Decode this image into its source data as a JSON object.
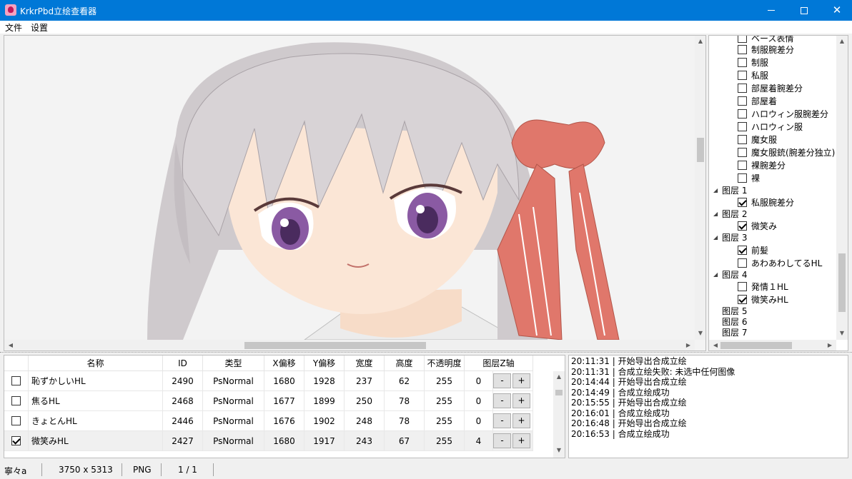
{
  "window": {
    "title": "KrkrPbd立绘查看器"
  },
  "menu": {
    "file": "文件",
    "settings": "设置"
  },
  "tree": {
    "items": [
      {
        "label": "ベース表情",
        "checked": false
      },
      {
        "label": "制服腕差分",
        "checked": false
      },
      {
        "label": "制服",
        "checked": false
      },
      {
        "label": "私服",
        "checked": false
      },
      {
        "label": "部屋着腕差分",
        "checked": false
      },
      {
        "label": "部屋着",
        "checked": false
      },
      {
        "label": "ハロウィン服腕差分",
        "checked": false
      },
      {
        "label": "ハロウィン服",
        "checked": false
      },
      {
        "label": "魔女服",
        "checked": false
      },
      {
        "label": "魔女服銃(腕差分独立)",
        "checked": false
      },
      {
        "label": "裸腕差分",
        "checked": false
      },
      {
        "label": "裸",
        "checked": false
      }
    ],
    "groups": [
      {
        "label": "图层 1",
        "expanded": true,
        "children": [
          {
            "label": "私服腕差分",
            "checked": true
          }
        ]
      },
      {
        "label": "图层 2",
        "expanded": true,
        "children": [
          {
            "label": "微笑み",
            "checked": true
          }
        ]
      },
      {
        "label": "图层 3",
        "expanded": true,
        "children": [
          {
            "label": "前髪",
            "checked": true
          },
          {
            "label": "あわあわしてるHL",
            "checked": false
          }
        ]
      },
      {
        "label": "图层 4",
        "expanded": true,
        "children": [
          {
            "label": "発情１HL",
            "checked": false
          },
          {
            "label": "微笑みHL",
            "checked": true
          }
        ]
      },
      {
        "label": "图层 5"
      },
      {
        "label": "图层 6"
      },
      {
        "label": "图层 7"
      }
    ]
  },
  "table": {
    "columns": [
      "名称",
      "ID",
      "类型",
      "X偏移",
      "Y偏移",
      "宽度",
      "高度",
      "不透明度",
      "图层Z轴"
    ],
    "rows": [
      {
        "checked": false,
        "name": "恥ずかしいHL",
        "id": "2490",
        "type": "PsNormal",
        "x": "1680",
        "y": "1928",
        "w": "237",
        "h": "62",
        "opacity": "255",
        "z": "0"
      },
      {
        "checked": false,
        "name": "焦るHL",
        "id": "2468",
        "type": "PsNormal",
        "x": "1677",
        "y": "1899",
        "w": "250",
        "h": "78",
        "opacity": "255",
        "z": "0"
      },
      {
        "checked": false,
        "name": "きょとんHL",
        "id": "2446",
        "type": "PsNormal",
        "x": "1676",
        "y": "1902",
        "w": "248",
        "h": "78",
        "opacity": "255",
        "z": "0"
      },
      {
        "checked": true,
        "name": "微笑みHL",
        "id": "2427",
        "type": "PsNormal",
        "x": "1680",
        "y": "1917",
        "w": "243",
        "h": "67",
        "opacity": "255",
        "z": "4"
      }
    ],
    "minus_label": "-",
    "plus_label": "+"
  },
  "log": [
    "20:11:31 | 开始导出合成立绘",
    "20:11:31 | 合成立绘失败: 未选中任何图像",
    "20:14:44 | 开始导出合成立绘",
    "20:14:49 | 合成立绘成功",
    "20:15:55 | 开始导出合成立绘",
    "20:16:01 | 合成立绘成功",
    "20:16:48 | 开始导出合成立绘",
    "20:16:53 | 合成立绘成功"
  ],
  "status": {
    "name": "寧々a",
    "size": "3750 x 5313",
    "format": "PNG",
    "page": "1 / 1"
  },
  "colors": {
    "titlebar": "#0078d7",
    "ribbon": "#e0776b",
    "hair": "#c9c3c6",
    "eyes": "#8a5aa3"
  }
}
